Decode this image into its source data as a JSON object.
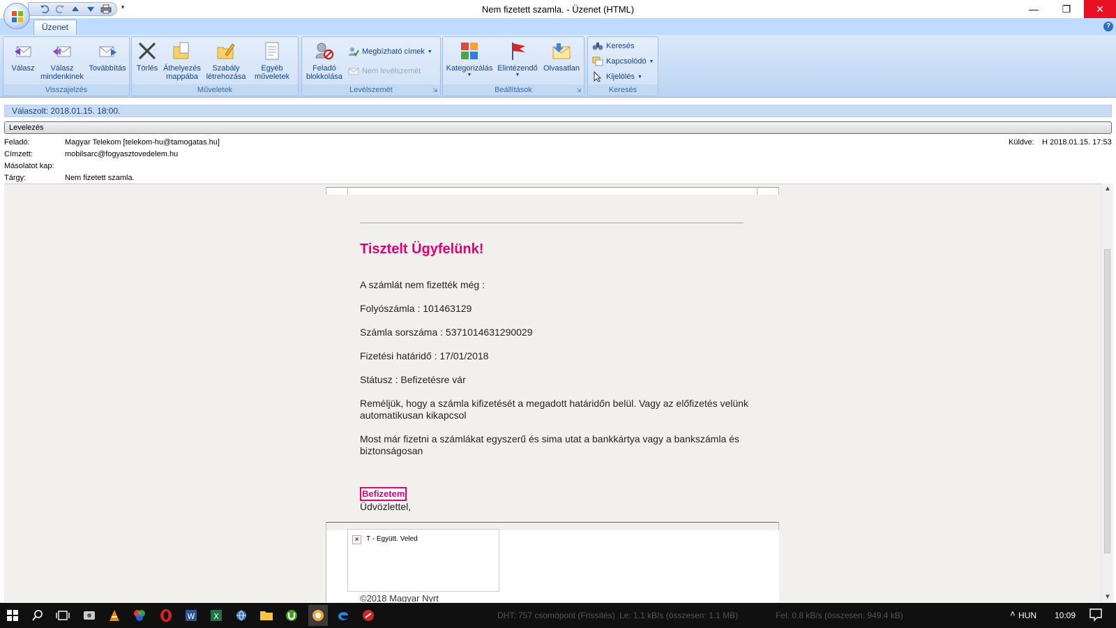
{
  "window": {
    "title": "Nem fizetett szamla. - Üzenet (HTML)",
    "minimize": "—",
    "restore": "❐",
    "close": "✕"
  },
  "qat": {
    "more": "▾"
  },
  "ribbon": {
    "tab": "Üzenet",
    "help": "?",
    "groups": {
      "visszajelzes": {
        "label": "Visszajelzés",
        "reply": "Válasz",
        "reply_all_1": "Válasz",
        "reply_all_2": "mindenkinek",
        "forward": "Továbbítás"
      },
      "muveletek": {
        "label": "Műveletek",
        "delete": "Törlés",
        "move_1": "Áthelyezés",
        "move_2": "mappába",
        "rule_1": "Szabály",
        "rule_2": "létrehozása",
        "other_1": "Egyéb",
        "other_2": "műveletek"
      },
      "levelszemet": {
        "label": "Levélszemét",
        "block_1": "Feladó",
        "block_2": "blokkolása",
        "safe": "Megbízható címek",
        "not_junk": "Nem levélszemét"
      },
      "beallitasok": {
        "label": "Beállítások",
        "categorize": "Kategorizálás",
        "followup": "Elintézendő",
        "unread": "Olvasatlan"
      },
      "kereses": {
        "label": "Keresés",
        "find": "Keresés",
        "related": "Kapcsolódó",
        "select": "Kijelölés"
      }
    }
  },
  "infobar": "Válaszolt: 2018.01.15. 18:00.",
  "category": "Levelezés",
  "headers": {
    "from_label": "Feladó:",
    "from": "Magyar Telekom [telekom-hu@tamogatas.hu]",
    "to_label": "Címzett:",
    "to": "mobilsarc@fogyasztovedelem.hu",
    "cc_label": "Másolatot kap:",
    "cc": "",
    "subject_label": "Tárgy:",
    "subject": "Nem fizetett szamla.",
    "sent_label": "Küldve:",
    "sent": "H 2018.01.15. 17:53"
  },
  "body": {
    "greeting": "Tisztelt Ügyfelünk!",
    "line1": "A számlát nem fizették még :",
    "line2": "Folyószámla : 101463129",
    "line3": "Számla sorszáma : 5371014631290029",
    "line4": "Fizetési határidő : 17/01/2018",
    "line5": "Státusz : Befizetésre vár",
    "para1": "Reméljük, hogy a számla kifizetését a megadott határidőn belül. Vagy az előfizetés velünk automatikusan kikapcsol",
    "para2": "Most már fizetni a számlákat egyszerű és sima utat a bankkártya vagy a bankszámla és biztonságosan",
    "pay_link": "Befizetem",
    "closing": "Üdvözlettel,",
    "image_alt": "T - Együtt. Veled",
    "copyright": "©2018 Magyar Nyrt"
  },
  "taskbar": {
    "dht": "DHT: 757 csomópont (Frissítés)",
    "down": "Le: 1.1 kB/s (összesen: 1.1 MB)",
    "up": "Fel: 0.8 kB/s (összesen: 949.4 kB)",
    "lang": "HUN",
    "time": "10:09"
  },
  "colors": {
    "telekom_magenta": "#e20074",
    "ribbon_blue": "#bfdbff",
    "close_red": "#e81123"
  }
}
